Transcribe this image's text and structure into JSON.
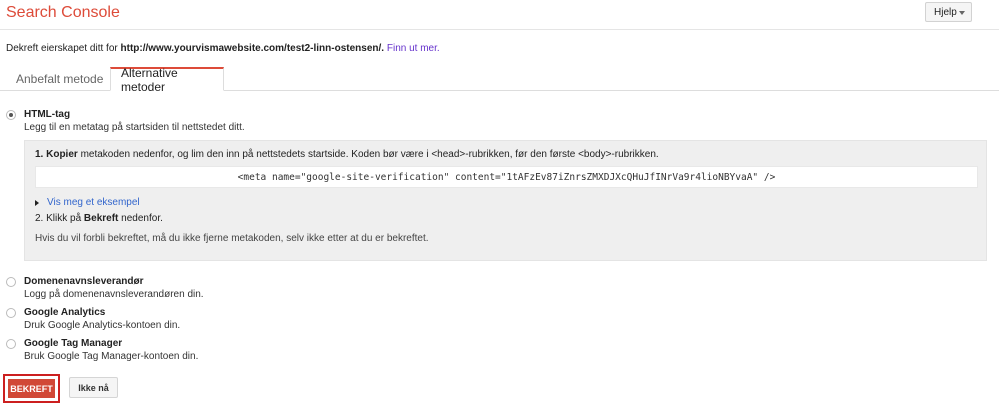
{
  "header": {
    "app_title": "Search Console",
    "help_label": "Hjelp"
  },
  "verify": {
    "prefix": "Dekreft eierskapet ditt for",
    "site_url": "http://www.yourvismawebsite.com/test2-linn-ostensen/.",
    "learn_more": "Finn ut mer."
  },
  "tabs": [
    {
      "label": "Anbefalt metode",
      "active": false
    },
    {
      "label": "Alternative metoder",
      "active": true
    }
  ],
  "methods": {
    "html_tag": {
      "title": "HTML-tag",
      "description": "Legg til en metatag på startsiden til nettstedet ditt.",
      "selected": true,
      "step1_bold": "1. Kopier",
      "step1_text": " metakoden nedenfor, og lim den inn på nettstedets startside. Koden bør være i <head>-rubrikken, før den første <body>-rubrikken.",
      "meta_code": "<meta name=\"google-site-verification\" content=\"1tAFzEv87iZnrsZMXDJXcQHuJfINrVa9r4lioNBYvaA\" />",
      "show_example": "Vis meg et eksempel",
      "step2_prefix": "2. Klikk på ",
      "step2_bold": "Bekreft",
      "step2_suffix": " nedenfor.",
      "note": "Hvis du vil forbli bekreftet, må du ikke fjerne metakoden, selv ikke etter at du er bekreftet."
    },
    "domain_provider": {
      "title": "Domenenavnsleverandør",
      "description": "Logg på domenenavnsleverandøren din."
    },
    "google_analytics": {
      "title": "Google Analytics",
      "description": "Druk Google Analytics-kontoen din."
    },
    "google_tag_manager": {
      "title": "Google Tag Manager",
      "description": "Bruk Google Tag Manager-kontoen din."
    }
  },
  "actions": {
    "confirm_label": "BEKREFT",
    "cancel_label": "Ikke nå"
  },
  "colors": {
    "brand_red": "#dd4b39",
    "confirm_button": "#d14836",
    "highlight_outline": "#cc1f1f",
    "link_blue": "#3366cc",
    "link_purple": "#6633cc"
  },
  "icons": {
    "help_dropdown": "chevron-down-icon",
    "example_toggle": "triangle-right-icon"
  }
}
